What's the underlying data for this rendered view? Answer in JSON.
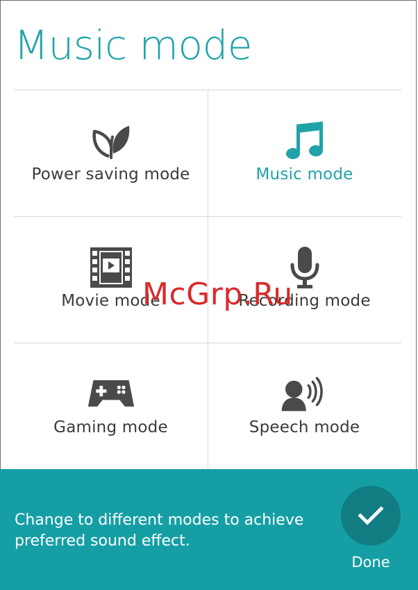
{
  "screen": {
    "title": "Music mode"
  },
  "modes": [
    {
      "id": "power-saving",
      "label": "Power saving mode",
      "icon": "leaf-icon",
      "selected": false
    },
    {
      "id": "music",
      "label": "Music mode",
      "icon": "music-note-icon",
      "selected": true
    },
    {
      "id": "movie",
      "label": "Movie mode",
      "icon": "film-icon",
      "selected": false
    },
    {
      "id": "recording",
      "label": "Recording mode",
      "icon": "microphone-icon",
      "selected": false
    },
    {
      "id": "gaming",
      "label": "Gaming mode",
      "icon": "gamepad-icon",
      "selected": false
    },
    {
      "id": "speech",
      "label": "Speech mode",
      "icon": "speaker-person-icon",
      "selected": false
    }
  ],
  "footer": {
    "message": "Change to different modes to achieve preferred sound effect.",
    "done_label": "Done",
    "done_icon": "checkmark-icon"
  },
  "watermark": "McGrp.Ru",
  "colors": {
    "accent": "#1fa3a8",
    "footer_bg": "#159fa5",
    "done_button": "#117d82",
    "icon": "#4a4a4a",
    "watermark": "#d92a2a"
  }
}
